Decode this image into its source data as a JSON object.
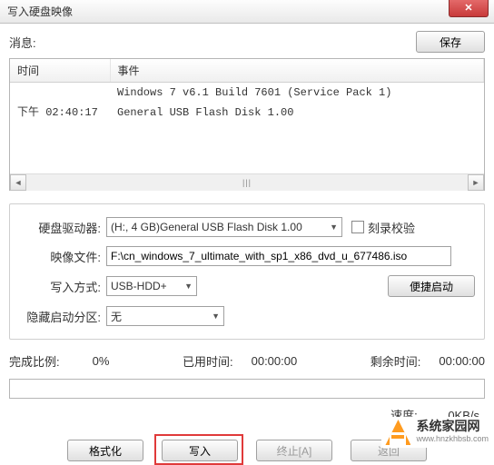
{
  "window": {
    "title": "写入硬盘映像"
  },
  "topbar": {
    "message_label": "消息:",
    "save_label": "保存"
  },
  "log": {
    "col_time": "时间",
    "col_event": "事件",
    "rows": [
      {
        "time": "",
        "event": "Windows 7 v6.1 Build 7601 (Service Pack 1)"
      },
      {
        "time": "下午 02:40:17",
        "event": "General USB Flash Disk  1.00"
      }
    ]
  },
  "form": {
    "drive_label": "硬盘驱动器:",
    "drive_value": "(H:, 4 GB)General USB Flash Disk  1.00",
    "verify_label": "刻录校验",
    "image_label": "映像文件:",
    "image_value": "F:\\cn_windows_7_ultimate_with_sp1_x86_dvd_u_677486.iso",
    "method_label": "写入方式:",
    "method_value": "USB-HDD+",
    "quickboot_label": "便捷启动",
    "hidden_label": "隐藏启动分区:",
    "hidden_value": "无"
  },
  "progress": {
    "done_label": "完成比例:",
    "done_value": "0%",
    "elapsed_label": "已用时间:",
    "elapsed_value": "00:00:00",
    "remain_label": "剩余时间:",
    "remain_value": "00:00:00",
    "speed_label": "速度:",
    "speed_value": "0KB/s"
  },
  "buttons": {
    "format": "格式化",
    "write": "写入",
    "abort": "终止[A]",
    "back": "返回"
  },
  "watermark": {
    "text": "系统家园网",
    "url": "www.hnzkhbsb.com"
  }
}
